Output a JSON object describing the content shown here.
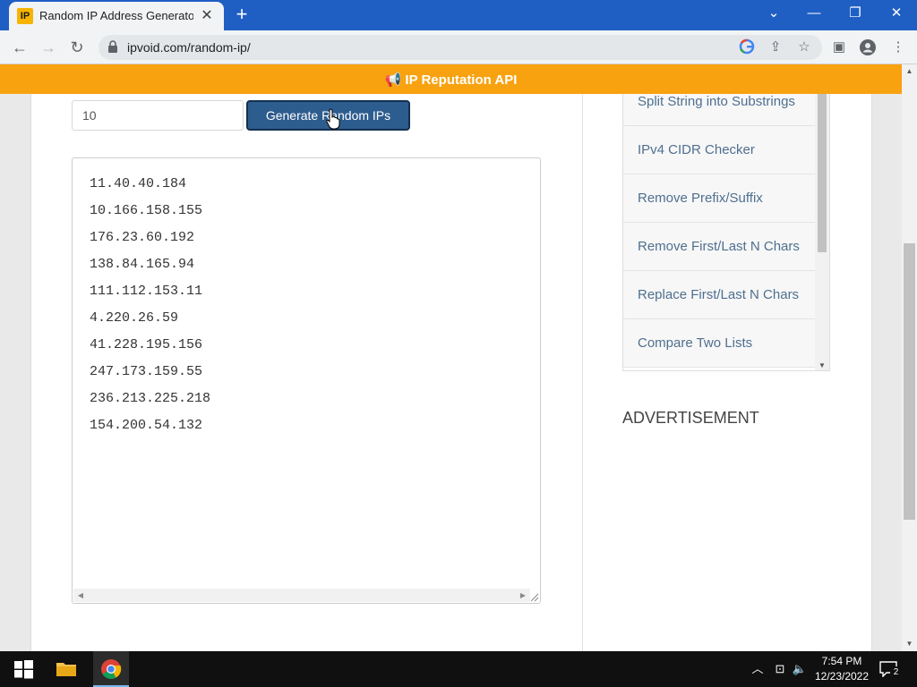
{
  "browser": {
    "tab_title": "Random IP Address Generator, C",
    "favicon_text": "IP",
    "url": "ipvoid.com/random-ip/"
  },
  "banner": {
    "text": "📢 IP Reputation API"
  },
  "generator": {
    "count_value": "10",
    "button_label": "Generate Random IPs",
    "ips": [
      "11.40.40.184",
      "10.166.158.155",
      "176.23.60.192",
      "138.84.165.94",
      "111.112.153.11",
      "4.220.26.59",
      "41.228.195.156",
      "247.173.159.55",
      "236.213.225.218",
      "154.200.54.132"
    ]
  },
  "sidebar": {
    "items": [
      {
        "label": "Split String into Substrings"
      },
      {
        "label": "IPv4 CIDR Checker"
      },
      {
        "label": "Remove Prefix/Suffix"
      },
      {
        "label": "Remove First/Last N Chars"
      },
      {
        "label": "Replace First/Last N Chars"
      },
      {
        "label": "Compare Two Lists"
      }
    ],
    "advertisement_label": "ADVERTISEMENT"
  },
  "taskbar": {
    "time": "7:54 PM",
    "date": "12/23/2022",
    "notification_count": "2"
  },
  "colors": {
    "titlebar": "#1f5fc4",
    "banner": "#f8a210",
    "button": "#2d5c8e",
    "link": "#4f6f8f"
  }
}
